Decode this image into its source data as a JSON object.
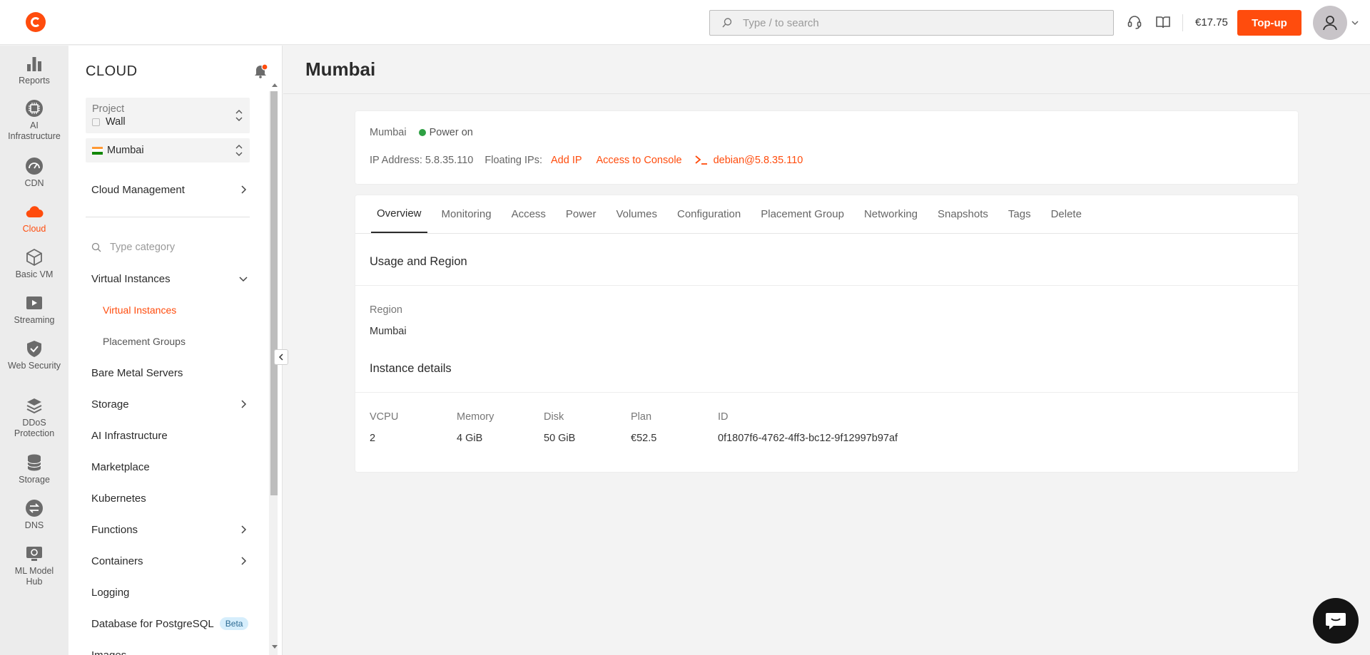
{
  "topbar": {
    "search_placeholder": "Type / to search",
    "balance": "€17.75",
    "topup_label": "Top-up"
  },
  "rail": {
    "items": [
      {
        "label": "Reports",
        "icon": "bar-chart-icon"
      },
      {
        "label": "AI Infrastructure",
        "icon": "chip-icon"
      },
      {
        "label": "CDN",
        "icon": "speedometer-icon"
      },
      {
        "label": "Cloud",
        "icon": "cloud-icon",
        "active": true
      },
      {
        "label": "Basic VM",
        "icon": "cube-icon"
      },
      {
        "label": "Streaming",
        "icon": "play-icon"
      },
      {
        "label": "Web Security",
        "icon": "shield-check-icon"
      },
      {
        "label": "DDoS Protection",
        "icon": "layers-icon"
      },
      {
        "label": "Storage",
        "icon": "database-icon"
      },
      {
        "label": "DNS",
        "icon": "dns-icon"
      },
      {
        "label": "ML Model Hub",
        "icon": "ml-model-icon"
      }
    ]
  },
  "sidebar": {
    "title": "CLOUD",
    "project": {
      "label": "Project",
      "value": "Wall"
    },
    "region": {
      "value": "Mumbai"
    },
    "cloud_management": "Cloud Management",
    "category_placeholder": "Type category",
    "nav": [
      {
        "label": "Virtual Instances"
      },
      {
        "label": "Virtual Instances",
        "sub": true,
        "active": true
      },
      {
        "label": "Placement Groups",
        "sub": true
      },
      {
        "label": "Bare Metal Servers"
      },
      {
        "label": "Storage"
      },
      {
        "label": "AI Infrastructure"
      },
      {
        "label": "Marketplace"
      },
      {
        "label": "Kubernetes"
      },
      {
        "label": "Functions"
      },
      {
        "label": "Containers"
      },
      {
        "label": "Logging"
      },
      {
        "label": "Database for PostgreSQL",
        "badge": "Beta"
      },
      {
        "label": "Images"
      }
    ]
  },
  "main": {
    "title": "Mumbai",
    "info": {
      "name": "Mumbai",
      "status": "Power on",
      "ip_address": "IP Address: 5.8.35.110",
      "floating_ips_label": "Floating IPs:",
      "add_ip": "Add IP",
      "console": "Access to Console",
      "ssh": "debian@5.8.35.110"
    },
    "tabs": [
      "Overview",
      "Monitoring",
      "Access",
      "Power",
      "Volumes",
      "Configuration",
      "Placement Group",
      "Networking",
      "Snapshots",
      "Tags",
      "Delete"
    ],
    "usage_title": "Usage and Region",
    "region_label": "Region",
    "region_value": "Mumbai",
    "details_title": "Instance details",
    "details": [
      {
        "label": "VCPU",
        "value": "2"
      },
      {
        "label": "Memory",
        "value": "4 GiB"
      },
      {
        "label": "Disk",
        "value": "50 GiB"
      },
      {
        "label": "Plan",
        "value": "€52.5"
      },
      {
        "label": "ID",
        "value": "0f1807f6-4762-4ff3-bc12-9f12997b97af"
      }
    ]
  },
  "colors": {
    "accent": "#ff4c0d",
    "status_on": "#2ea043",
    "beta_bg": "#d6eefc"
  }
}
